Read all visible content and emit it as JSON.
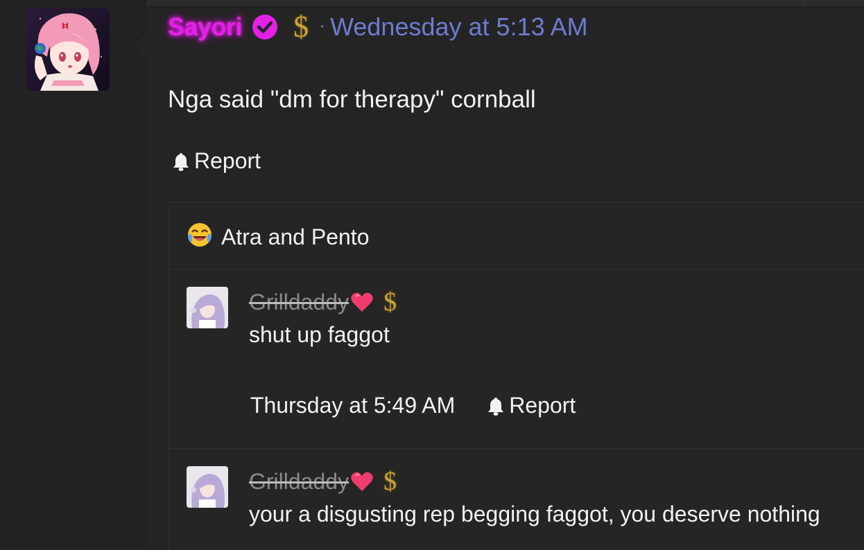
{
  "post": {
    "username": "Sayori",
    "separator": "·",
    "timestamp": "Wednesday at 5:13 AM",
    "message": "Nga said \"dm for therapy\" cornball",
    "report_label": "Report",
    "currency_symbol": "$"
  },
  "reactions": {
    "emoji": "crying-laughing-emoji",
    "text": "Atra and Pento"
  },
  "comments": [
    {
      "username": "Grilldaddy",
      "currency_symbol": "$",
      "text": "shut up faggot",
      "timestamp": "Thursday at 5:49 AM",
      "report_label": "Report"
    },
    {
      "username": "Grilldaddy",
      "currency_symbol": "$",
      "text": "your a disgusting rep begging faggot, you deserve nothing"
    }
  ],
  "colors": {
    "username": "#e321e6",
    "timestamp": "#6f7bd1",
    "dollar": "#caa23b",
    "background": "#242424"
  }
}
